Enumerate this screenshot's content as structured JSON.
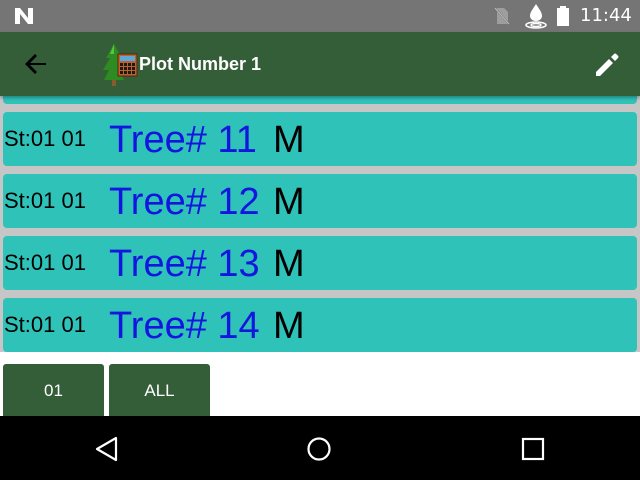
{
  "status_bar": {
    "time": "11:44",
    "icons": [
      "n-logo-icon",
      "no-sim-icon",
      "water-drop-icon",
      "battery-icon"
    ]
  },
  "app_bar": {
    "title": "Plot Number 1",
    "back_icon": "arrow-back-icon",
    "logo_icon": "tree-plot-logo-icon",
    "edit_icon": "pencil-icon",
    "color": "#345e38"
  },
  "list": {
    "row_color": "#2fc2b8",
    "tree_text_color": "#1515e0",
    "items": [
      {
        "st": "St:01 01",
        "tree": "Tree# 11",
        "status": "M"
      },
      {
        "st": "St:01 01",
        "tree": "Tree# 12",
        "status": "M"
      },
      {
        "st": "St:01 01",
        "tree": "Tree# 13",
        "status": "M"
      },
      {
        "st": "St:01 01",
        "tree": "Tree# 14",
        "status": "M"
      }
    ]
  },
  "filter_bar": {
    "buttons": [
      {
        "label": "01"
      },
      {
        "label": "ALL"
      }
    ]
  },
  "nav_bar": {
    "icons": [
      "nav-back-icon",
      "nav-home-icon",
      "nav-recents-icon"
    ]
  }
}
